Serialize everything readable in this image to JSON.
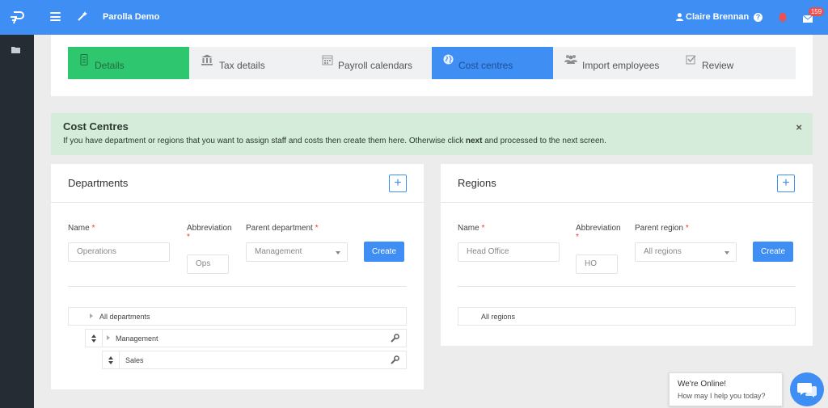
{
  "app": {
    "title": "Parolla Demo",
    "logo_icon": "parolla-logo-icon"
  },
  "user": {
    "name": "Claire Brennan",
    "mail_badge": "159"
  },
  "wizard": {
    "steps": [
      {
        "label": "Details",
        "icon": "phone-icon",
        "state": "done"
      },
      {
        "label": "Tax details",
        "icon": "bank-icon",
        "state": "default"
      },
      {
        "label": "Payroll calendars",
        "icon": "calendar-icon",
        "state": "default"
      },
      {
        "label": "Cost centres",
        "icon": "globe-icon",
        "state": "active"
      },
      {
        "label": "Import employees",
        "icon": "users-icon",
        "state": "default"
      },
      {
        "label": "Review",
        "icon": "checkbox-icon",
        "state": "default"
      }
    ]
  },
  "alert": {
    "title": "Cost Centres",
    "text_before": "If you have department or regions that you want to assign staff and costs then create them here. Otherwise click ",
    "text_bold": "next",
    "text_after": " and processed to the next screen.",
    "close": "×"
  },
  "departments": {
    "title": "Departments",
    "add": "+",
    "name_label": "Name",
    "abbr_label": "Abbreviation",
    "parent_label": "Parent department",
    "required_mark": "*",
    "name_placeholder": "Operations",
    "abbr_placeholder": "Ops",
    "parent_value": "Management",
    "create": "Create",
    "tree": {
      "root": "All departments",
      "child": "Management",
      "grandchild": "Sales"
    }
  },
  "regions": {
    "title": "Regions",
    "add": "+",
    "name_label": "Name",
    "abbr_label": "Abbreviation",
    "parent_label": "Parent region",
    "required_mark": "*",
    "name_placeholder": "Head Office",
    "abbr_placeholder": "HO",
    "parent_value": "All regions",
    "create": "Create",
    "tree": {
      "root": "All regions"
    }
  },
  "chat": {
    "title": "We're Online!",
    "subtitle": "How may I help you today?"
  },
  "colors": {
    "primary": "#3f8ef3",
    "success": "#2ec66e",
    "alert_bg": "#d6ecdb",
    "sidebar": "#262c33",
    "badge": "#ef4f4f"
  }
}
